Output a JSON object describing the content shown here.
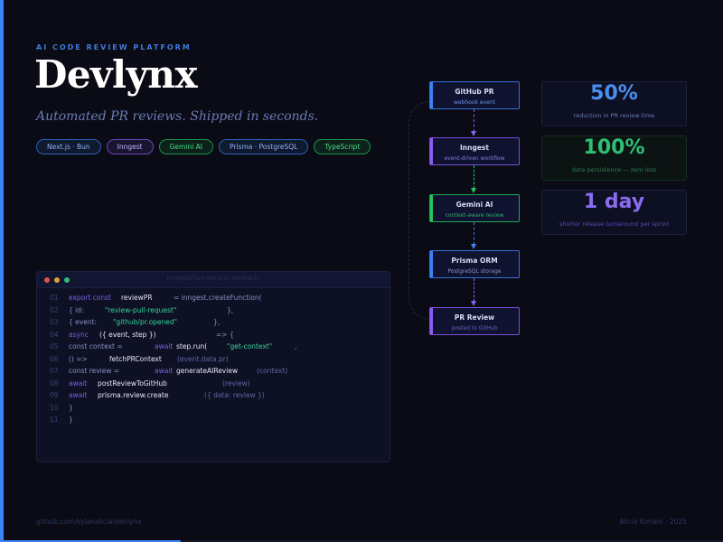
{
  "header": {
    "eyebrow": "AI CODE REVIEW PLATFORM",
    "title": "Devlynx",
    "subtitle": "Automated PR reviews. Shipped in seconds."
  },
  "badges": [
    {
      "label": "Next.js · Bun",
      "color": "#3b82f6"
    },
    {
      "label": "Inngest",
      "color": "#8b5cf6"
    },
    {
      "label": "Gemini AI",
      "color": "#22c55e"
    },
    {
      "label": "Prisma · PostgreSQL",
      "color": "#3b82f6"
    },
    {
      "label": "TypeScript",
      "color": "#22c55e"
    }
  ],
  "code": {
    "filename": "inngest/functions/ai-review.ts",
    "lines": [
      {
        "num": "01",
        "tokens": [
          [
            "export const",
            "kw",
            0
          ],
          [
            "reviewPR",
            "fn",
            58
          ],
          [
            "= inngest.createFunction(",
            "pl",
            116
          ]
        ]
      },
      {
        "num": "02",
        "tokens": [
          [
            "{ id:",
            "pl",
            0
          ],
          [
            "\"review-pull-request\"",
            "str",
            40
          ],
          [
            "},",
            "pl",
            175
          ]
        ]
      },
      {
        "num": "03",
        "tokens": [
          [
            "{ event:",
            "pl",
            0
          ],
          [
            "\"github/pr.opened\"",
            "str",
            49
          ],
          [
            "},",
            "pl",
            160
          ]
        ]
      },
      {
        "num": "04",
        "tokens": [
          [
            "async",
            "kw",
            0
          ],
          [
            "({ event, step })",
            "fn",
            34
          ],
          [
            "=> {",
            "pl",
            163
          ]
        ]
      },
      {
        "num": "05",
        "tokens": [
          [
            "const context =",
            "pl",
            0
          ],
          [
            "await",
            "kw",
            95
          ],
          [
            "step.run(",
            "fn",
            119
          ],
          [
            "\"get-context\"",
            "str",
            175
          ],
          [
            ",",
            "pl",
            250
          ]
        ]
      },
      {
        "num": "06",
        "tokens": [
          [
            "() =>",
            "pl",
            0
          ],
          [
            "fetchPRContext",
            "fn",
            45
          ],
          [
            "(event.data.pr)",
            "dim",
            120
          ]
        ]
      },
      {
        "num": "07",
        "tokens": [
          [
            "const review =",
            "pl",
            0
          ],
          [
            "await",
            "kw",
            95
          ],
          [
            "generateAIReview",
            "fn",
            119
          ],
          [
            "(context)",
            "dim",
            208
          ]
        ]
      },
      {
        "num": "08",
        "tokens": [
          [
            "await",
            "kw",
            0
          ],
          [
            "postReviewToGitHub",
            "fn",
            32
          ],
          [
            "(review)",
            "dim",
            170
          ]
        ]
      },
      {
        "num": "09",
        "tokens": [
          [
            "await",
            "kw",
            0
          ],
          [
            "prisma.review.create",
            "fn",
            32
          ],
          [
            "({ data: review })",
            "dim",
            150
          ]
        ]
      },
      {
        "num": "10",
        "tokens": [
          [
            "}",
            "pl",
            0
          ]
        ]
      },
      {
        "num": "11",
        "tokens": [
          [
            "}",
            "pl",
            0
          ]
        ]
      }
    ]
  },
  "pipeline": [
    {
      "title": "GitHub PR",
      "sub": "webhook event",
      "color": "#3b82f6",
      "subcolor": "#6b93e6"
    },
    {
      "title": "Inngest",
      "sub": "event-driven workflow",
      "color": "#8b5cf6",
      "subcolor": "#8f76e6"
    },
    {
      "title": "Gemini AI",
      "sub": "context-aware review",
      "color": "#22c55e",
      "subcolor": "#3aa872"
    },
    {
      "title": "Prisma ORM",
      "sub": "PostgreSQL storage",
      "color": "#3b82f6",
      "subcolor": "#8a96c8"
    },
    {
      "title": "PR Review",
      "sub": "posted to GitHub",
      "color": "#8b5cf6",
      "subcolor": "#6a5fc0"
    }
  ],
  "stats": [
    {
      "value": "50%",
      "label": "reduction in PR review time",
      "color": "#4a8ff0",
      "labelcolor": "#6b7bb8",
      "border": "#1c2140",
      "bg": "#0d1022"
    },
    {
      "value": "100%",
      "label": "data persistence — zero loss",
      "color": "#2fbf74",
      "labelcolor": "#2e7a55",
      "border": "#15301f",
      "bg": "#0b1412"
    },
    {
      "value": "1 day",
      "label": "shorter release turnaround per sprint",
      "color": "#8a6cf0",
      "labelcolor": "#5b48b8",
      "border": "#1c2140",
      "bg": "#0d1022"
    }
  ],
  "footer": {
    "left": "github.com/kylanalicia/devlynx",
    "right": "Alicia Kimani · 2025"
  },
  "progress": 0.25,
  "colors": {
    "accent": "#3b82f6",
    "background": "#0a0b14"
  }
}
